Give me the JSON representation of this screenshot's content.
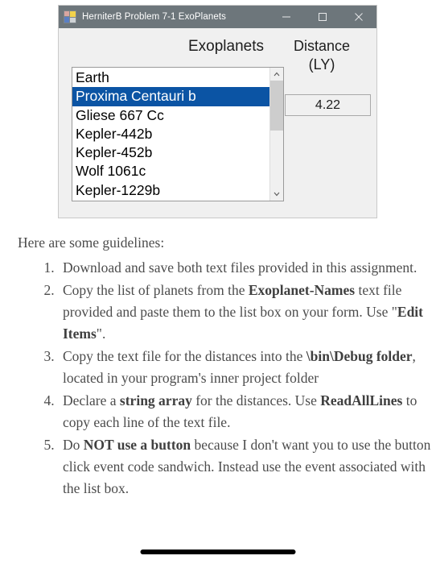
{
  "window": {
    "title": "HerniterB Problem 7-1 ExoPlanets",
    "icon": "app-squares-icon",
    "controls": {
      "minimize": "minimize-icon",
      "maximize": "maximize-icon",
      "close": "close-icon"
    },
    "titlebar_color": "#6d767b",
    "form_background": "#f0f0f0"
  },
  "form": {
    "list_label": "Exoplanets",
    "distance_label_line1": "Distance",
    "distance_label_line2": "(LY)",
    "distance_value": "4.22",
    "selection_color": "#0b54a4",
    "listbox": {
      "items": [
        "Earth",
        "Proxima Centauri b",
        "Gliese 667 Cc",
        "Kepler-442b",
        "Kepler-452b",
        "Wolf 1061c",
        "Kepler-1229b"
      ],
      "selected_index": 1,
      "scroll_up_icon": "chevron-up-icon",
      "scroll_down_icon": "chevron-down-icon"
    }
  },
  "document": {
    "intro": "Here are some guidelines:",
    "guidelines": [
      {
        "parts": [
          {
            "text": "Download and save both text files provided in this assignment.",
            "bold": false
          }
        ]
      },
      {
        "parts": [
          {
            "text": "Copy the list of planets from the ",
            "bold": false
          },
          {
            "text": "Exoplanet-Names",
            "bold": true
          },
          {
            "text": " text file provided and paste them to the list box on your form. Use \"",
            "bold": false
          },
          {
            "text": "Edit Items",
            "bold": true
          },
          {
            "text": "\".",
            "bold": false
          }
        ]
      },
      {
        "parts": [
          {
            "text": "Copy the text file for the distances into the ",
            "bold": false
          },
          {
            "text": "\\bin\\Debug folder",
            "bold": true
          },
          {
            "text": ", located in your program's inner project folder",
            "bold": false
          }
        ]
      },
      {
        "parts": [
          {
            "text": "Declare a ",
            "bold": false
          },
          {
            "text": "string array",
            "bold": true
          },
          {
            "text": " for the distances. Use ",
            "bold": false
          },
          {
            "text": "ReadAllLines",
            "bold": true
          },
          {
            "text": " to copy each line of the text file.",
            "bold": false
          }
        ]
      },
      {
        "parts": [
          {
            "text": "Do ",
            "bold": false
          },
          {
            "text": "NOT use a button",
            "bold": true
          },
          {
            "text": " because I don't want you to use the button click event code sandwich. Instead use the event associated with the list box.",
            "bold": false
          }
        ]
      }
    ]
  },
  "system": {
    "home_indicator": "home-indicator"
  }
}
